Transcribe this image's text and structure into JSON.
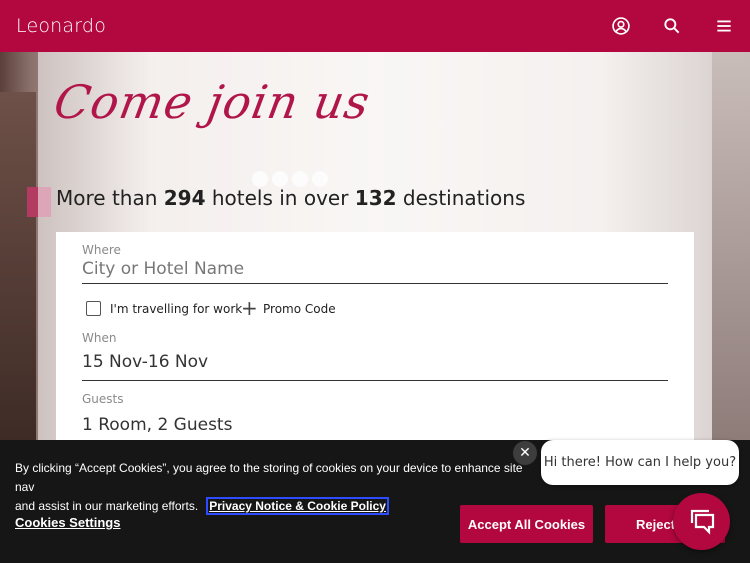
{
  "header": {
    "logo": "Leonardo",
    "icons": [
      "user-icon",
      "search-icon",
      "menu-icon"
    ],
    "color": "#b3073f"
  },
  "hero": {
    "script_title": "Come join us",
    "tagline_pre": "More than ",
    "hotel_count": "294",
    "tagline_mid": " hotels in over ",
    "destination_count": "132",
    "tagline_post": " destinations"
  },
  "form": {
    "where_label": "Where",
    "where_placeholder": "City or Hotel Name",
    "work_travel_label": "I'm travelling for work",
    "promo_label": "Promo Code",
    "when_label": "When",
    "when_value": "15 Nov-16 Nov",
    "guests_label": "Guests",
    "guests_value": "1 Room, 2 Guests"
  },
  "cookie": {
    "text": "By clicking “Accept Cookies”, you agree to the storing of cookies on your device to enhance site nav",
    "text2": "and assist in our marketing efforts.",
    "link": "Privacy Notice & Cookie Policy",
    "settings": "Cookies Settings",
    "accept": "Accept All Cookies",
    "reject": "Reject"
  },
  "chat": {
    "greeting": "Hi there! How can I help you?"
  }
}
